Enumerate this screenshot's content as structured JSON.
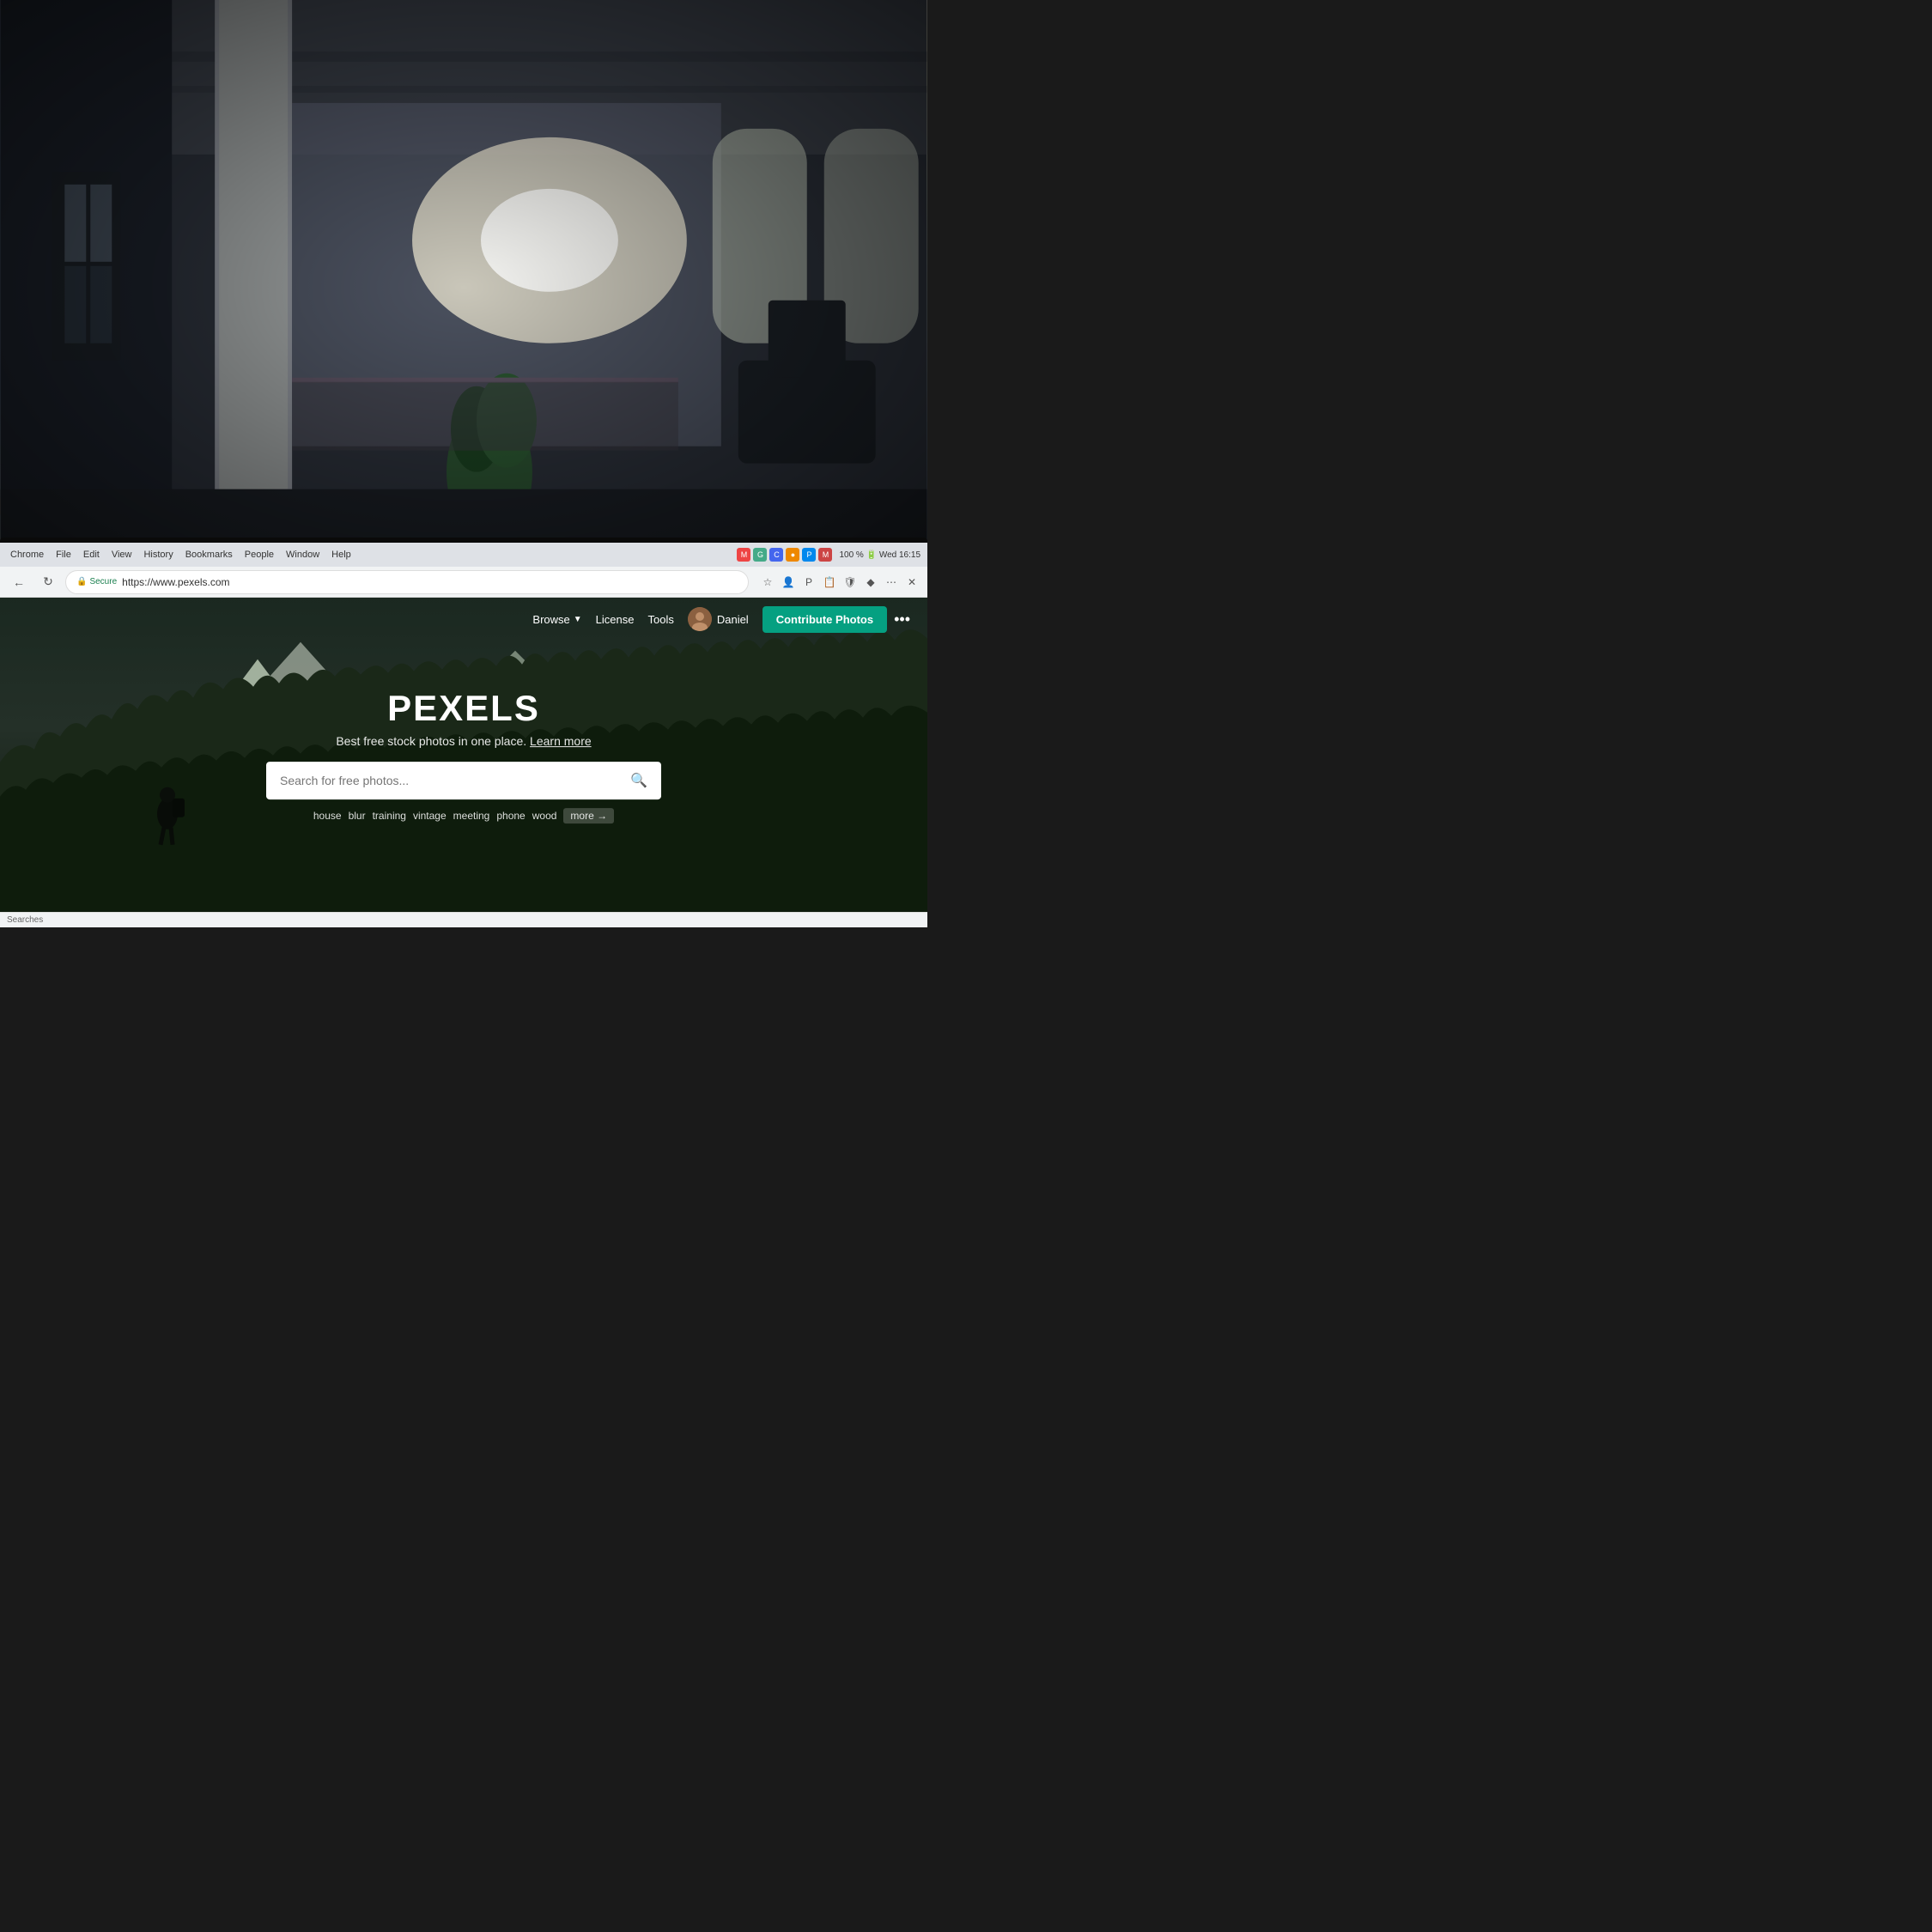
{
  "background": {
    "alt": "Office interior with large windows and natural light"
  },
  "browser": {
    "menu_items": [
      "Chrome",
      "File",
      "Edit",
      "View",
      "History",
      "Bookmarks",
      "People",
      "Window",
      "Help"
    ],
    "system_info": "100 % 🔋 Wed 16:15",
    "secure_label": "Secure",
    "url": "https://www.pexels.com",
    "back_btn": "←",
    "reload_btn": "↻"
  },
  "pexels": {
    "nav": {
      "browse": "Browse",
      "license": "License",
      "tools": "Tools",
      "username": "Daniel",
      "contribute_btn": "Contribute Photos",
      "more_icon": "•••"
    },
    "hero": {
      "logo": "PEXELS",
      "tagline": "Best free stock photos in one place.",
      "learn_more": "Learn more",
      "search_placeholder": "Search for free photos...",
      "suggestions": [
        "house",
        "blur",
        "training",
        "vintage",
        "meeting",
        "phone",
        "wood"
      ],
      "more_label": "more →"
    }
  },
  "status_bar": {
    "text": "Searches"
  }
}
